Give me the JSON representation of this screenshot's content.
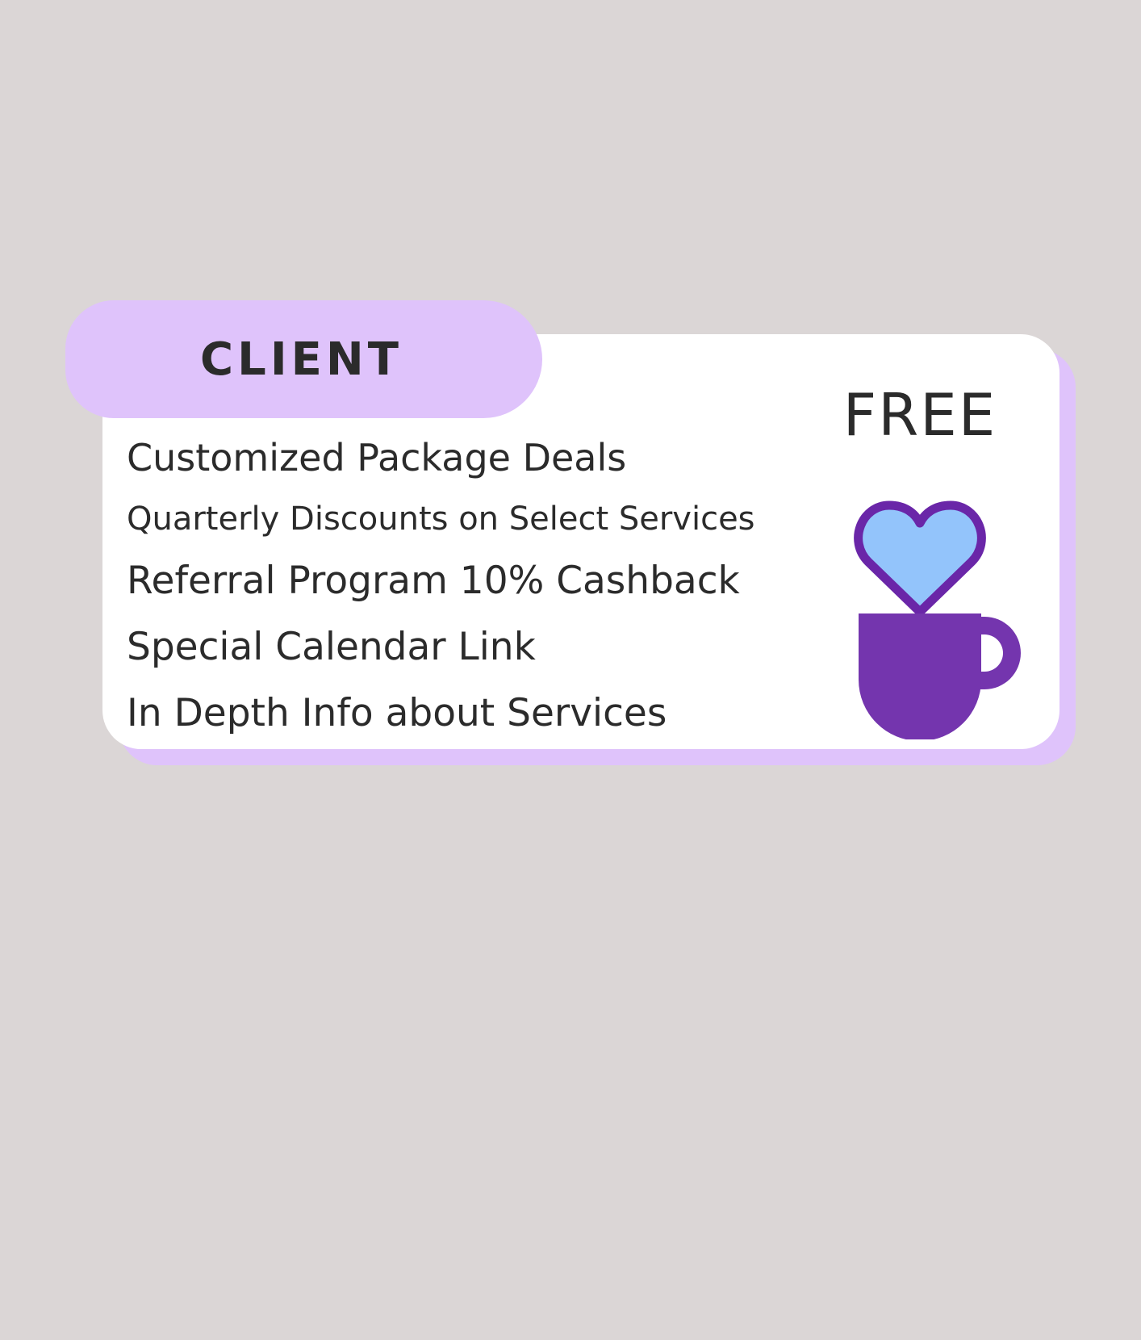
{
  "tier": {
    "name": "CLIENT",
    "price": "FREE",
    "features": [
      "Customized Package Deals",
      "Quarterly Discounts on Select Services",
      "Referral Program 10% Cashback",
      "Special Calendar Link",
      "In Depth Info about Services"
    ],
    "icon": "heart-coffee-cup-icon"
  },
  "colors": {
    "background": "#dbd6d6",
    "accent_lavender": "#dfc3fb",
    "card": "#ffffff",
    "text": "#2b2b2b",
    "cup_purple": "#7435ae",
    "heart_outline": "#6a26a8",
    "heart_fill": "#93c4fb"
  }
}
